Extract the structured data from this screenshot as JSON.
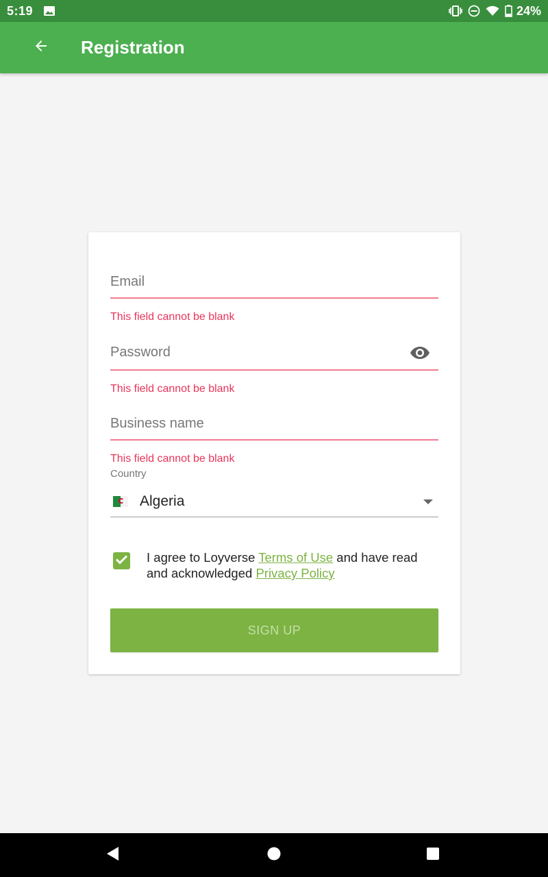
{
  "status_bar": {
    "time": "5:19",
    "battery_percent": "24%"
  },
  "app_bar": {
    "title": "Registration",
    "color": "#4caf50"
  },
  "form": {
    "email": {
      "placeholder": "Email",
      "value": "",
      "error": "This field cannot be blank"
    },
    "password": {
      "placeholder": "Password",
      "value": "",
      "error": "This field cannot be blank"
    },
    "business_name": {
      "placeholder": "Business name",
      "value": "",
      "error": "This field cannot be blank"
    },
    "country": {
      "label": "Country",
      "value": "Algeria"
    },
    "agreement": {
      "checked": true,
      "text_before": "I agree to Loyverse ",
      "terms_link": "Terms of Use",
      "text_middle": " and have read and acknowledged ",
      "privacy_link": "Privacy Policy"
    },
    "signup_label": "SIGN UP"
  },
  "colors": {
    "accent": "#7cb342",
    "error": "#e8345a",
    "status_bar": "#388e3c"
  },
  "icons": {
    "back": "arrow-back-icon",
    "password_toggle": "eye-icon",
    "country_flag": "algeria-flag-icon",
    "dropdown": "dropdown-arrow-icon",
    "checkbox": "checkmark-icon",
    "nav_back": "nav-back-icon",
    "nav_home": "nav-home-icon",
    "nav_recents": "nav-recents-icon"
  }
}
